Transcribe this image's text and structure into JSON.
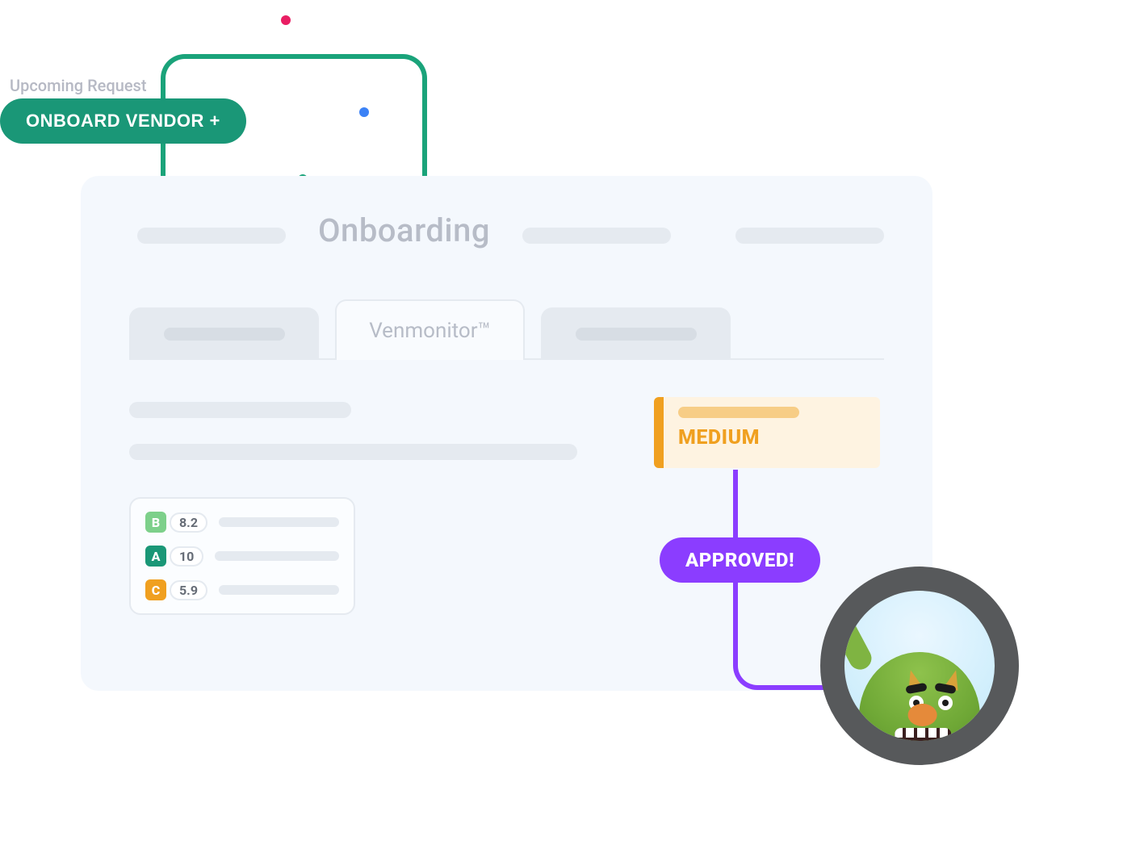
{
  "upcoming_label": "Upcoming Request",
  "onboard_button": "ONBOARD VENDOR +",
  "card": {
    "title": "Onboarding",
    "active_tab": "Venmonitor™"
  },
  "risk": {
    "label": "MEDIUM"
  },
  "scores": [
    {
      "grade": "B",
      "value": "8.2"
    },
    {
      "grade": "A",
      "value": "10"
    },
    {
      "grade": "C",
      "value": "5.9"
    }
  ],
  "approved_label": "APPROVED!",
  "colors": {
    "brand_green": "#1a9777",
    "accent_amber": "#f0a020",
    "accent_purple": "#8b3dff"
  }
}
